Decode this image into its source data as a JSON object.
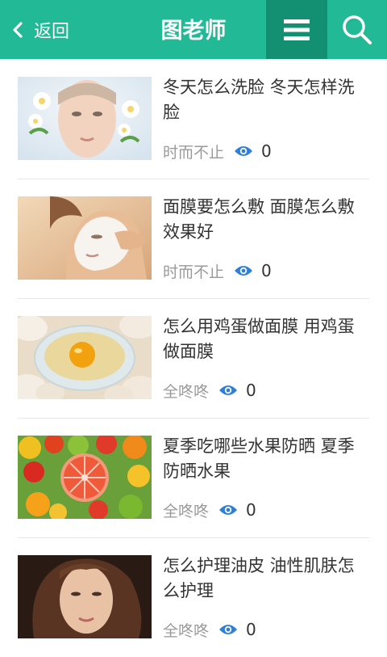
{
  "header": {
    "back_label": "返回",
    "title": "图老师",
    "accent_color": "#22b996",
    "menu_icon": "menu-icon",
    "search_icon": "search-icon"
  },
  "articles": [
    {
      "title": "冬天怎么洗脸 冬天怎样洗脸",
      "author": "时而不止",
      "views": "0",
      "thumb": "woman-face-with-flowers"
    },
    {
      "title": "面膜要怎么敷 面膜怎么敷效果好",
      "author": "时而不止",
      "views": "0",
      "thumb": "woman-with-face-mask"
    },
    {
      "title": "怎么用鸡蛋做面膜 用鸡蛋做面膜",
      "author": "全咚咚",
      "views": "0",
      "thumb": "egg-yolk-bowl"
    },
    {
      "title": "夏季吃哪些水果防晒 夏季防晒水果",
      "author": "全咚咚",
      "views": "0",
      "thumb": "fruit-assortment"
    },
    {
      "title": "怎么护理油皮 油性肌肤怎么护理",
      "author": "全咚咚",
      "views": "0",
      "thumb": "woman-portrait"
    }
  ]
}
